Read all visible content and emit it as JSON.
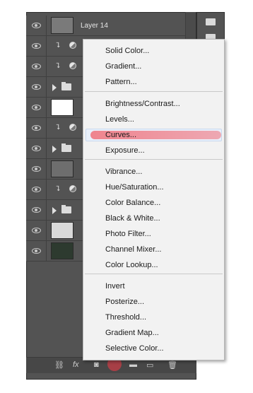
{
  "layers": [
    {
      "type": "image",
      "name": "Layer 14",
      "thumb": "#7a7a7a"
    },
    {
      "type": "adjustment"
    },
    {
      "type": "adjustment"
    },
    {
      "type": "group"
    },
    {
      "type": "image",
      "thumb": "#ffffff"
    },
    {
      "type": "adjustment"
    },
    {
      "type": "group"
    },
    {
      "type": "image",
      "thumb": "#6e6e6e"
    },
    {
      "type": "adjustment"
    },
    {
      "type": "group"
    },
    {
      "type": "image",
      "thumb": "#d9d9d9"
    },
    {
      "type": "image",
      "thumb": "#2d3a2f"
    }
  ],
  "menu": {
    "items": [
      "Solid Color...",
      "Gradient...",
      "Pattern...",
      "Brightness/Contrast...",
      "Levels...",
      "Curves...",
      "Exposure...",
      "Vibrance...",
      "Hue/Saturation...",
      "Color Balance...",
      "Black & White...",
      "Photo Filter...",
      "Channel Mixer...",
      "Color Lookup...",
      "Invert",
      "Posterize...",
      "Threshold...",
      "Gradient Map...",
      "Selective Color..."
    ],
    "selected_index": 5
  },
  "bottom_bar": {
    "fx_label": "fx"
  },
  "colors": {
    "panel": "#535353",
    "menu_bg": "#f2f2f2",
    "highlight": "#e8707c"
  }
}
